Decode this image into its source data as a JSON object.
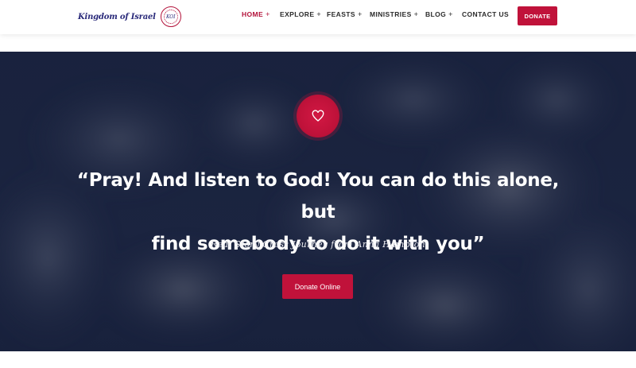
{
  "brand": {
    "name": "Kingdom of Israel",
    "seal_text": "KOI"
  },
  "nav": {
    "items": [
      {
        "label": "HOME",
        "has_submenu": true,
        "active": true
      },
      {
        "label": "EXPLORE",
        "has_submenu": true,
        "active": false
      },
      {
        "label": "FEASTS",
        "has_submenu": true,
        "active": false
      },
      {
        "label": "MINISTRIES",
        "has_submenu": true,
        "active": false
      },
      {
        "label": "BLOG",
        "has_submenu": true,
        "active": false
      },
      {
        "label": "CONTACT US",
        "has_submenu": false,
        "active": false
      }
    ],
    "submenu_glyph": "+",
    "donate_label": "DONATE"
  },
  "hero": {
    "icon": "heart-icon",
    "quote_line1": "“Pray! And listen to God! You can do this alone, but",
    "quote_line2": "find somebody to do it with you”",
    "attribution": "Real Story Cross Journey from Anna Hampton",
    "cta_label": "Donate Online"
  },
  "colors": {
    "accent": "#c0123a",
    "hero_overlay": "#1b2541",
    "nav_text": "#2b2b2b",
    "brand_text": "#2a2a7a"
  }
}
